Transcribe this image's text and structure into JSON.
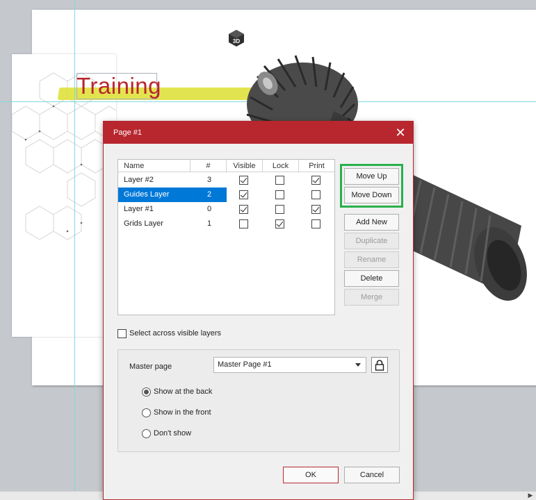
{
  "background": {
    "title_text": "Training",
    "badge_text": "3D"
  },
  "dialog": {
    "title": "Page #1",
    "close_glyph": "✕",
    "table": {
      "headers": [
        "Name",
        "#",
        "Visible",
        "Lock",
        "Print"
      ],
      "rows": [
        {
          "name": "Layer #2",
          "num": "3",
          "visible": true,
          "lock": false,
          "print": true,
          "selected": false
        },
        {
          "name": "Guides Layer",
          "num": "2",
          "visible": true,
          "lock": false,
          "print": false,
          "selected": true
        },
        {
          "name": "Layer #1",
          "num": "0",
          "visible": true,
          "lock": false,
          "print": true,
          "selected": false
        },
        {
          "name": "Grids Layer",
          "num": "1",
          "visible": false,
          "lock": true,
          "print": false,
          "selected": false
        }
      ]
    },
    "buttons": {
      "move_up": "Move Up",
      "move_down": "Move Down",
      "add_new": "Add New",
      "duplicate": "Duplicate",
      "rename": "Rename",
      "delete": "Delete",
      "merge": "Merge",
      "ok": "OK",
      "cancel": "Cancel"
    },
    "select_across_label": "Select across visible layers",
    "select_across_checked": false,
    "master_page": {
      "label": "Master page",
      "value": "Master Page #1",
      "options": [
        {
          "label": "Show at the back",
          "checked": true
        },
        {
          "label": "Show in the front",
          "checked": false
        },
        {
          "label": "Don't show",
          "checked": false
        }
      ]
    }
  },
  "colors": {
    "accent_red": "#b8262e",
    "selection_blue": "#0078d7",
    "highlight_green": "#28b04a",
    "title_red": "#b8252d",
    "marker_yellow": "#dfe13c"
  }
}
